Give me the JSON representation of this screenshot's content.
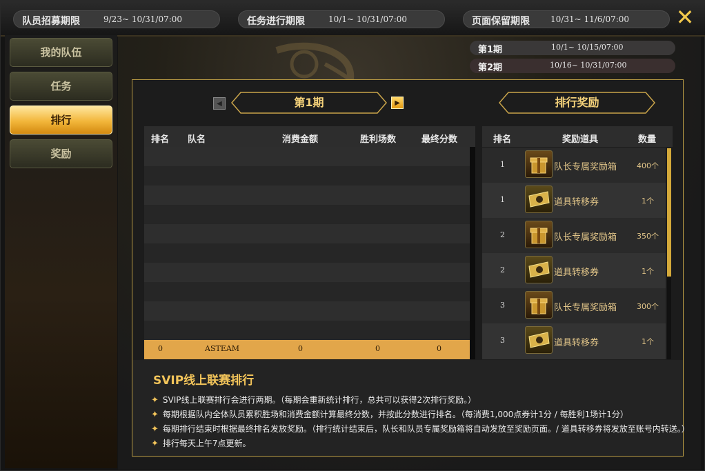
{
  "header": {
    "recruit_label": "队员招募期限",
    "recruit_value": "9/23~ 10/31/07:00",
    "task_label": "任务进行期限",
    "task_value": "10/1~ 10/31/07:00",
    "keep_label": "页面保留期限",
    "keep_value": "10/31~ 11/6/07:00",
    "close_glyph": "✕"
  },
  "nav": {
    "items": [
      {
        "label": "我的队伍"
      },
      {
        "label": "任务"
      },
      {
        "label": "排行"
      },
      {
        "label": "奖励"
      }
    ],
    "active": "排行"
  },
  "periods": [
    {
      "label": "第1期",
      "value": "10/1~ 10/15/07:00"
    },
    {
      "label": "第2期",
      "value": "10/16~ 10/31/07:00"
    }
  ],
  "ranking": {
    "period_title": "第1期",
    "prev_icon": "◀",
    "next_icon": "▶",
    "columns": [
      "排名",
      "队名",
      "消费金额",
      "胜利场数",
      "最终分数"
    ],
    "my_row": {
      "rank": "0",
      "team": "ASTEAM",
      "spend": "0",
      "wins": "0",
      "score": "0"
    }
  },
  "rewards": {
    "title": "排行奖励",
    "columns": [
      "排名",
      "奖励道具",
      "数量"
    ],
    "rows": [
      {
        "rank": "1",
        "item": "队长专属奖励箱",
        "qty": "400个",
        "icon": "gift-box-icon"
      },
      {
        "rank": "1",
        "item": "道具转移券",
        "qty": "1个",
        "icon": "ticket-icon"
      },
      {
        "rank": "2",
        "item": "队长专属奖励箱",
        "qty": "350个",
        "icon": "gift-box-icon"
      },
      {
        "rank": "2",
        "item": "道具转移券",
        "qty": "1个",
        "icon": "ticket-icon"
      },
      {
        "rank": "3",
        "item": "队长专属奖励箱",
        "qty": "300个",
        "icon": "gift-box-icon"
      },
      {
        "rank": "3",
        "item": "道具转移券",
        "qty": "1个",
        "icon": "ticket-icon"
      }
    ]
  },
  "description": {
    "title": "SVIP线上联赛排行",
    "rules": [
      "SVIP线上联赛排行会进行两期。（每期会重新统计排行，总共可以获得2次排行奖励。）",
      "每期根据队内全体队员累积胜场和消费金额计算最终分数，并按此分数进行排名。（每消费1,000点券计1分 / 每胜利1场计1分）",
      "每期排行结束时根据最终排名发放奖励。（排行统计结束后，队长和队员专属奖励箱将自动发放至奖励页面。/ 道具转移券将发放至账号内转送。）",
      "排行每天上午7点更新。"
    ]
  },
  "colors": {
    "accent": "#f2b63a",
    "gold_text": "#f2c45a",
    "highlight_row": "#e2a64a"
  }
}
